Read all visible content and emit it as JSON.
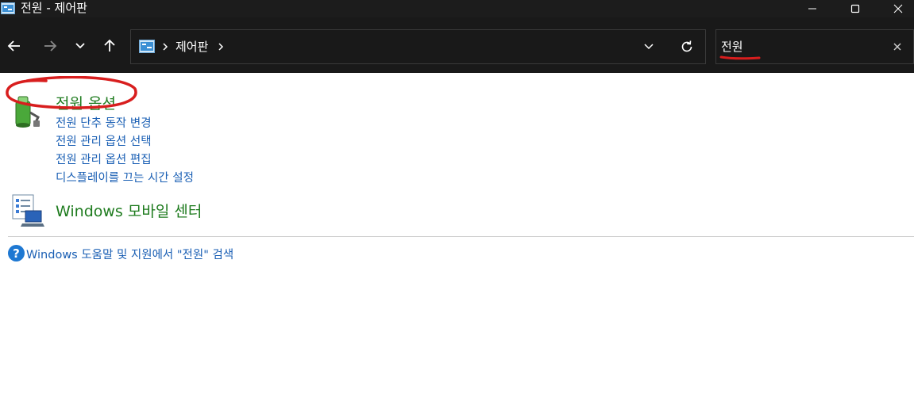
{
  "window": {
    "title": "전원 - 제어판"
  },
  "address_bar": {
    "crumbs": [
      "제어판"
    ]
  },
  "search": {
    "value": "전원"
  },
  "results": {
    "power_options": {
      "title": "전원 옵션",
      "tasks": [
        "전원 단추 동작 변경",
        "전원 관리 옵션 선택",
        "전원 관리 옵션 편집",
        "디스플레이를 끄는 시간 설정"
      ]
    },
    "mobility_center": {
      "title": "Windows 모바일 센터"
    },
    "help_search": "Windows 도움말 및 지원에서 \"전원\" 검색"
  },
  "colors": {
    "category_title": "#1e7b1e",
    "link": "#1a5fb4",
    "annotation": "#d81e1e",
    "titlebar": "#1c1c1c",
    "navbar": "#191919"
  },
  "icons": {
    "title": "control-panel-icon",
    "address": "control-panel-icon",
    "power": "power-options-icon",
    "mobility": "mobility-center-icon",
    "help": "help-icon"
  }
}
